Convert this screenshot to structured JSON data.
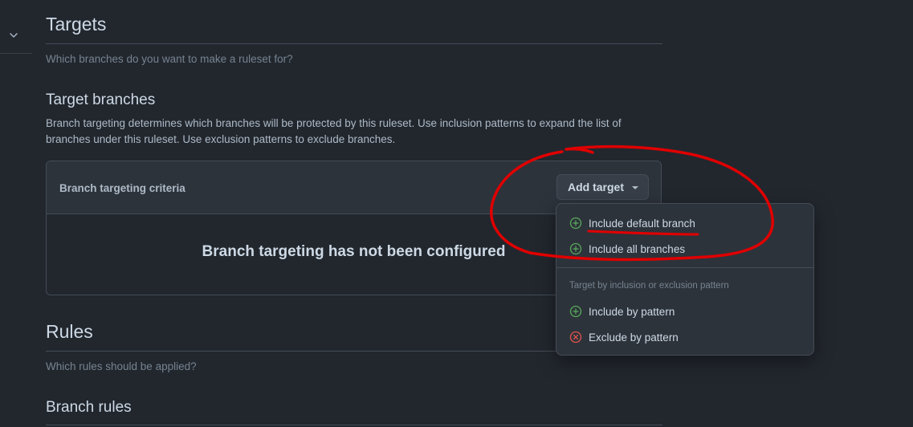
{
  "targets": {
    "title": "Targets",
    "subtitle": "Which branches do you want to make a ruleset for?"
  },
  "target_branches": {
    "title": "Target branches",
    "description": "Branch targeting determines which branches will be protected by this ruleset. Use inclusion patterns to expand the list of branches under this ruleset. Use exclusion patterns to exclude branches."
  },
  "criteria": {
    "title": "Branch targeting criteria",
    "add_target_label": "Add target",
    "empty_message": "Branch targeting has not been configured"
  },
  "menu": {
    "items": [
      {
        "label": "Include default branch",
        "icon": "plus-circle-icon"
      },
      {
        "label": "Include all branches",
        "icon": "plus-circle-icon"
      }
    ],
    "group_label": "Target by inclusion or exclusion pattern",
    "pattern_items": [
      {
        "label": "Include by pattern",
        "icon": "plus-circle-icon"
      },
      {
        "label": "Exclude by pattern",
        "icon": "x-circle-icon"
      }
    ]
  },
  "rules": {
    "title": "Rules",
    "subtitle": "Which rules should be applied?"
  },
  "branch_rules": {
    "title": "Branch rules"
  },
  "colors": {
    "background": "#22272e",
    "include_green": "#57ab5a",
    "exclude_red": "#e5534b",
    "annotation_red": "#e00000"
  }
}
